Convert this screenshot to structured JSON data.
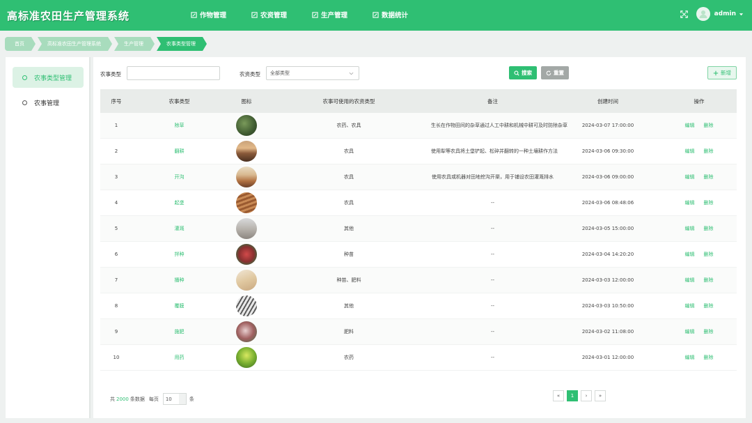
{
  "app": {
    "title": "高标准农田生产管理系统"
  },
  "topnav": [
    {
      "label": "作物管理"
    },
    {
      "label": "农资管理"
    },
    {
      "label": "生产管理"
    },
    {
      "label": "数据统计"
    }
  ],
  "user": {
    "name": "admin"
  },
  "breadcrumb": [
    "首页",
    "高标准农田生产管理系统",
    "生产管理",
    "农事类型管理"
  ],
  "sidebar": [
    {
      "label": "农事类型管理",
      "active": true
    },
    {
      "label": "农事管理",
      "active": false
    }
  ],
  "filters": {
    "type_label": "农事类型",
    "type_value": "",
    "resource_label": "农资类型",
    "resource_value": "全部类型"
  },
  "buttons": {
    "search": "搜索",
    "reset": "重置",
    "add": "新增"
  },
  "table": {
    "headers": [
      "序号",
      "农事类型",
      "图标",
      "农事可使用的农资类型",
      "备注",
      "创建时间",
      "操作"
    ],
    "rows": [
      {
        "seq": "1",
        "type": "除草",
        "resource": "农药、农具",
        "note": "生长在作物田间的杂草通过人工中耕和机械中耕可及时防除杂草",
        "time": "2024-03-07 17:00:00",
        "thumb": "weeds"
      },
      {
        "seq": "2",
        "type": "翻耕",
        "resource": "农具",
        "note": "使用犁等农具将土垡铲起、松碎并翻转的一种土壤耕作方法",
        "time": "2024-03-06 09:30:00",
        "thumb": "tillage"
      },
      {
        "seq": "3",
        "type": "开沟",
        "resource": "农具",
        "note": "使用农具或机器对田地挖沟开渠，用于铺设农田灌溉排水",
        "time": "2024-03-06 09:00:00",
        "thumb": "ditch"
      },
      {
        "seq": "4",
        "type": "起垄",
        "resource": "农具",
        "note": "--",
        "time": "2024-03-06 08:48:06",
        "thumb": "ridge"
      },
      {
        "seq": "5",
        "type": "灌溉",
        "resource": "其他",
        "note": "--",
        "time": "2024-03-05 15:00:00",
        "thumb": "irrigation"
      },
      {
        "seq": "6",
        "type": "拌种",
        "resource": "种苗",
        "note": "--",
        "time": "2024-03-04 14:20:20",
        "thumb": "seedmix"
      },
      {
        "seq": "7",
        "type": "播种",
        "resource": "种苗、肥料",
        "note": "--",
        "time": "2024-03-03 12:00:00",
        "thumb": "sowing"
      },
      {
        "seq": "8",
        "type": "覆膜",
        "resource": "其他",
        "note": "--",
        "time": "2024-03-03 10:50:00",
        "thumb": "film"
      },
      {
        "seq": "9",
        "type": "施肥",
        "resource": "肥料",
        "note": "--",
        "time": "2024-03-02 11:08:00",
        "thumb": "fertilize"
      },
      {
        "seq": "10",
        "type": "用药",
        "resource": "农药",
        "note": "--",
        "time": "2024-03-01 12:00:00",
        "thumb": "spray"
      }
    ],
    "edit_label": "编辑",
    "delete_label": "删除"
  },
  "pagination": {
    "prefix": "共",
    "total": "2000",
    "suffix": "条数据",
    "per_page_label": "每页",
    "per_page_value": "10",
    "unit": "条",
    "current_page": "1"
  },
  "colors": {
    "primary": "#2fbf73",
    "header_bg": "#2fbf73"
  }
}
